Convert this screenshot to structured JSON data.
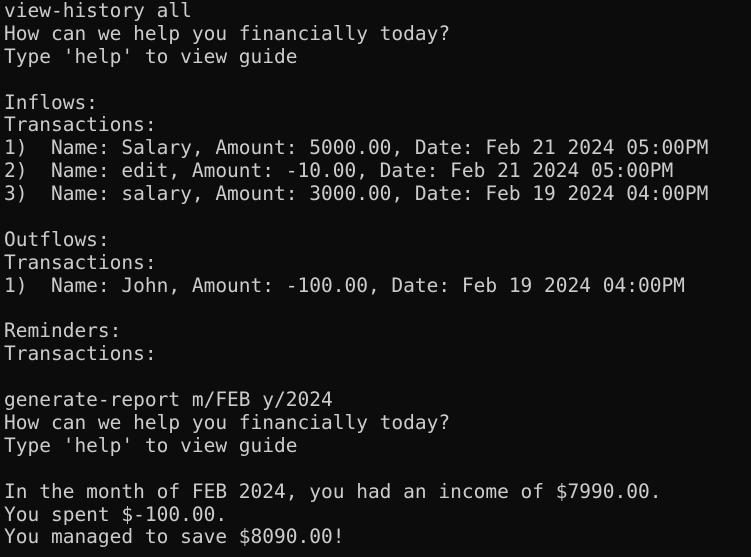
{
  "terminal": {
    "lines": [
      "view-history all",
      "How can we help you financially today?",
      "Type 'help' to view guide",
      "",
      "Inflows:",
      "Transactions:",
      "1)  Name: Salary, Amount: 5000.00, Date: Feb 21 2024 05:00PM",
      "2)  Name: edit, Amount: -10.00, Date: Feb 21 2024 05:00PM",
      "3)  Name: salary, Amount: 3000.00, Date: Feb 19 2024 04:00PM",
      "",
      "Outflows:",
      "Transactions:",
      "1)  Name: John, Amount: -100.00, Date: Feb 19 2024 04:00PM",
      "",
      "Reminders:",
      "Transactions:",
      "",
      "generate-report m/FEB y/2024",
      "How can we help you financially today?",
      "Type 'help' to view guide",
      "",
      "In the month of FEB 2024, you had an income of $7990.00.",
      "You spent $-100.00.",
      "You managed to save $8090.00!"
    ],
    "colors": {
      "background": "#0c0c0c",
      "text": "#cccccc"
    }
  }
}
